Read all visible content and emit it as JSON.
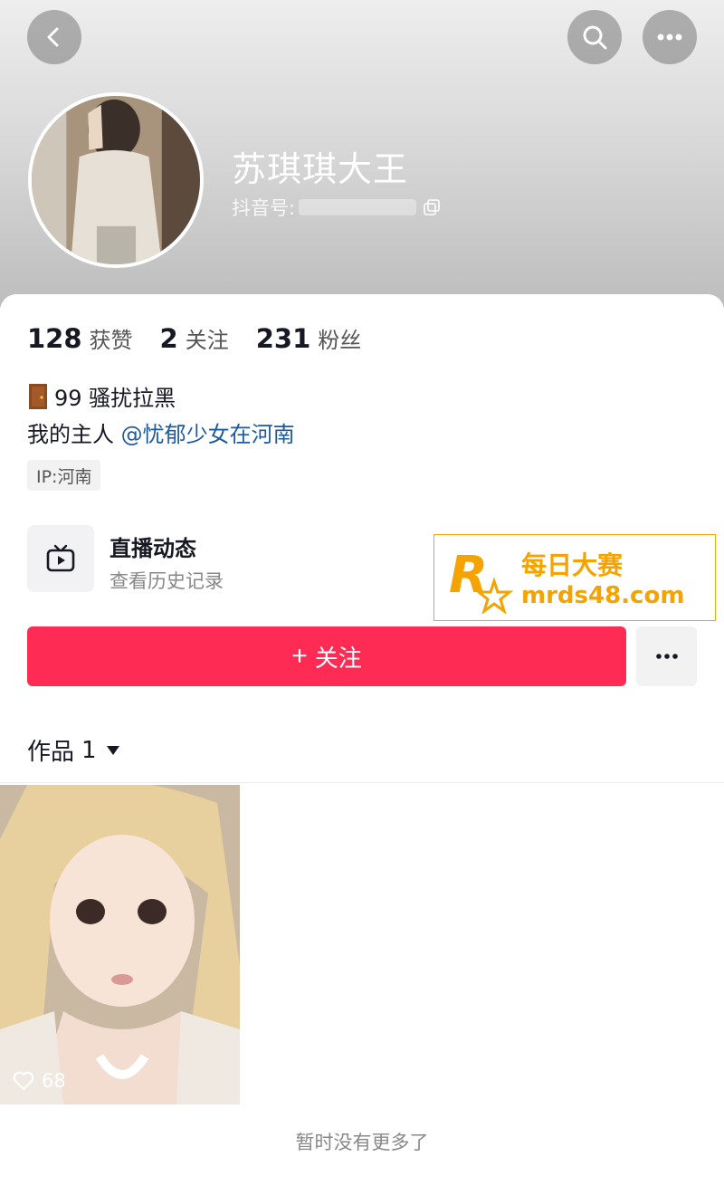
{
  "header": {
    "name": "苏琪琪大王",
    "douyin_id_label": "抖音号:",
    "icons": [
      "back-icon",
      "search-icon",
      "more-icon",
      "copy-icon"
    ]
  },
  "stats": {
    "likes_num": "128",
    "likes_label": "获赞",
    "following_num": "2",
    "following_label": "关注",
    "followers_num": "231",
    "followers_label": "粉丝"
  },
  "bio": {
    "line1": "99 骚扰拉黑",
    "line2_prefix": "我的主人 ",
    "mention": "@忧郁少女在河南"
  },
  "ip_tag": "IP:河南",
  "live": {
    "title": "直播动态",
    "subtitle": "查看历史记录",
    "icon": "tv-icon"
  },
  "watermark": {
    "cn": "每日大赛",
    "url": "mrds48.com"
  },
  "actions": {
    "follow_label": "关注",
    "follow_plus": "+",
    "more_icon": "more-icon"
  },
  "works": {
    "label": "作品",
    "count": "1",
    "items": [
      {
        "likes": "68"
      }
    ]
  },
  "footer": {
    "no_more": "暂时没有更多了"
  },
  "colors": {
    "accent": "#fe2c55",
    "link": "#1d5aa0",
    "watermark": "#f4a300"
  }
}
